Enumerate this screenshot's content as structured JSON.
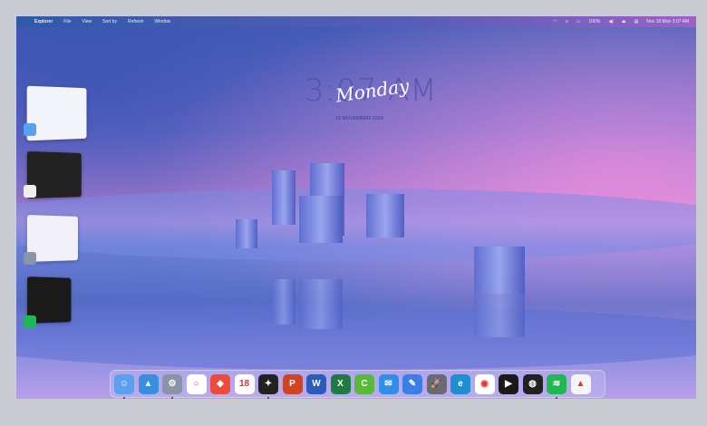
{
  "menubar": {
    "apple": "",
    "app": "Explorer",
    "items": [
      "File",
      "View",
      "Sort by",
      "Refresh",
      "Window"
    ],
    "status": {
      "battery": "100%",
      "clock": "Nov 18 Mon 3:07 AM"
    }
  },
  "lockclock": {
    "time": "3:07 AM",
    "day": "Monday",
    "date": "18 NOVEMBER 2024"
  },
  "stage": [
    {
      "app": "finder"
    },
    {
      "app": "eagle"
    },
    {
      "app": "settings"
    },
    {
      "app": "spotify"
    }
  ],
  "dock": [
    {
      "name": "finder",
      "color": "#5aa0f0",
      "glyph": "☺",
      "running": true
    },
    {
      "name": "photos",
      "color": "#3a8ee0",
      "glyph": "▲",
      "running": false
    },
    {
      "name": "settings",
      "color": "#8a94a8",
      "glyph": "⚙",
      "running": true
    },
    {
      "name": "cortana",
      "color": "#ffffff",
      "glyph": "○",
      "running": false
    },
    {
      "name": "anydesk",
      "color": "#ef4a3a",
      "glyph": "◆",
      "running": false
    },
    {
      "name": "calendar",
      "color": "#ffffff",
      "glyph": "18",
      "running": false
    },
    {
      "name": "eagle",
      "color": "#222222",
      "glyph": "✦",
      "running": true
    },
    {
      "name": "powerpoint",
      "color": "#d04423",
      "glyph": "P",
      "running": false
    },
    {
      "name": "word",
      "color": "#2b5cb8",
      "glyph": "W",
      "running": false
    },
    {
      "name": "excel",
      "color": "#1f7a44",
      "glyph": "X",
      "running": false
    },
    {
      "name": "camtasia",
      "color": "#5ab93a",
      "glyph": "C",
      "running": false
    },
    {
      "name": "mail",
      "color": "#2f8fe8",
      "glyph": "✉",
      "running": false
    },
    {
      "name": "paint",
      "color": "#3a7ee8",
      "glyph": "✎",
      "running": false
    },
    {
      "name": "launchpad",
      "color": "#6a6a72",
      "glyph": "🚀",
      "running": false
    },
    {
      "name": "edge",
      "color": "#1e8fd0",
      "glyph": "e",
      "running": false
    },
    {
      "name": "chrome",
      "color": "#ffffff",
      "glyph": "◉",
      "running": false
    },
    {
      "name": "media-player",
      "color": "#1a1a1a",
      "glyph": "▶",
      "running": false
    },
    {
      "name": "obs",
      "color": "#222222",
      "glyph": "◍",
      "running": false
    },
    {
      "name": "spotify",
      "color": "#1db954",
      "glyph": "≋",
      "running": true
    },
    {
      "name": "vlc",
      "color": "#f5f5f5",
      "glyph": "▲",
      "running": false
    }
  ]
}
